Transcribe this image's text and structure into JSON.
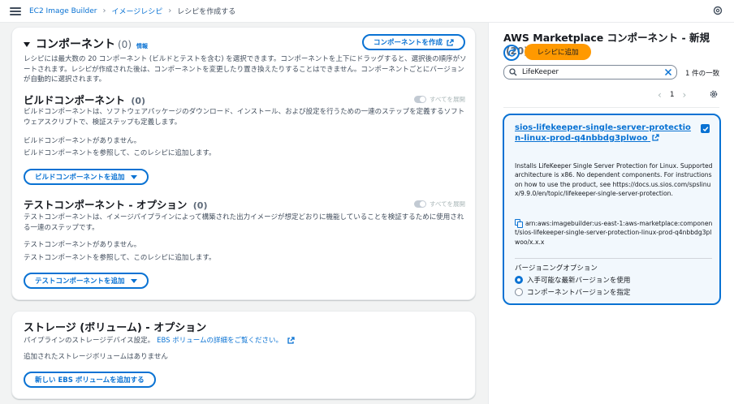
{
  "breadcrumb": {
    "items": [
      "EC2 Image Builder",
      "イメージレシピ"
    ],
    "current": "レシピを作成する"
  },
  "components": {
    "title": "コンポーネント",
    "count": "(0)",
    "info": "情報",
    "create_button": "コンポーネントを作成",
    "description": "レシピには最大数の 20 コンポーネント (ビルドとテストを含む) を選択できます。コンポーネントを上下にドラッグすると、選択後の順序がソートされます。レシピが作成された後は、コンポーネントを変更したり置き換えたりすることはできません。コンポーネントごとにバージョンが自動的に選択されます。",
    "build": {
      "title": "ビルドコンポーネント",
      "count": "(0)",
      "expand_all": "すべてを展開",
      "description": "ビルドコンポーネントは、ソフトウェアパッケージのダウンロード、インストール、および設定を行うための一連のステップを定義するソフトウェアスクリプトで、検証ステップも定義します。",
      "empty_title": "ビルドコンポーネントがありません。",
      "empty_desc": "ビルドコンポーネントを参照して、このレシピに追加します。",
      "add_button": "ビルドコンポーネントを追加"
    },
    "test": {
      "title": "テストコンポーネント - オプション",
      "count": "(0)",
      "expand_all": "すべてを展開",
      "description": "テストコンポーネントは、イメージパイプラインによって構築された出力イメージが想定どおりに機能していることを検証するために使用される一連のステップです。",
      "empty_title": "テストコンポーネントがありません。",
      "empty_desc": "テストコンポーネントを参照して、このレシピに追加します。",
      "add_button": "テストコンポーネントを追加"
    }
  },
  "storage": {
    "title": "ストレージ (ボリューム) - オプション",
    "description": "パイプラインのストレージデバイス設定。",
    "link": "EBS ボリュームの詳細をご覧ください。",
    "empty": "追加されたストレージボリュームはありません",
    "add_button": "新しい EBS ボリュームを追加する"
  },
  "marketplace": {
    "title": "AWS Marketplace コンポーネント - 新規",
    "count": "(20)",
    "add_button": "レシピに追加",
    "search_value": "LifeKeeper",
    "match_count": "1 件の一致",
    "page": "1",
    "card": {
      "title": "sios-lifekeeper-single-server-protection-linux-prod-q4nbbdg3plwoo",
      "description": "Installs LifeKeeper Single Server Protection for Linux. Supported architecture is x86. No dependent components. For instructions on how to use the product, see https://docs.us.sios.com/spslinux/9.9.0/en/topic/lifekeeper-single-server-protection.",
      "arn": "arn:aws:imagebuilder:us-east-1:aws-marketplace:component/sios-lifekeeper-single-server-protection-linux-prod-q4nbbdg3plwoo/x.x.x",
      "versioning_label": "バージョニングオプション",
      "option_latest": "入手可能な最新バージョンを使用",
      "option_specify": "コンポーネントバージョンを指定"
    }
  },
  "colors": {
    "accent": "#0972d3",
    "add_button": "#ff9900",
    "card_bg": "#f2f8fd"
  }
}
